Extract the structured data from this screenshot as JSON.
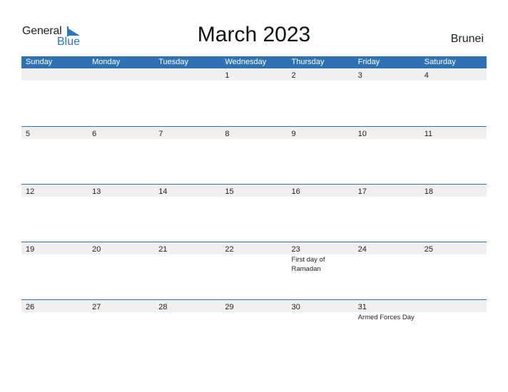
{
  "brand": {
    "part1": "General",
    "part2": "Blue",
    "accent": "#2a75bb"
  },
  "title": "March 2023",
  "country": "Brunei",
  "header_color": "#2e72b4",
  "weekdays": [
    "Sunday",
    "Monday",
    "Tuesday",
    "Wednesday",
    "Thursday",
    "Friday",
    "Saturday"
  ],
  "weeks": [
    {
      "days": [
        "",
        "",
        "",
        "1",
        "2",
        "3",
        "4"
      ],
      "events": [
        "",
        "",
        "",
        "",
        "",
        "",
        ""
      ]
    },
    {
      "days": [
        "5",
        "6",
        "7",
        "8",
        "9",
        "10",
        "11"
      ],
      "events": [
        "",
        "",
        "",
        "",
        "",
        "",
        ""
      ]
    },
    {
      "days": [
        "12",
        "13",
        "14",
        "15",
        "16",
        "17",
        "18"
      ],
      "events": [
        "",
        "",
        "",
        "",
        "",
        "",
        ""
      ]
    },
    {
      "days": [
        "19",
        "20",
        "21",
        "22",
        "23",
        "24",
        "25"
      ],
      "events": [
        "",
        "",
        "",
        "",
        "First day of Ramadan",
        "",
        ""
      ]
    },
    {
      "days": [
        "26",
        "27",
        "28",
        "29",
        "30",
        "31",
        ""
      ],
      "events": [
        "",
        "",
        "",
        "",
        "",
        "Armed Forces Day",
        ""
      ]
    }
  ]
}
